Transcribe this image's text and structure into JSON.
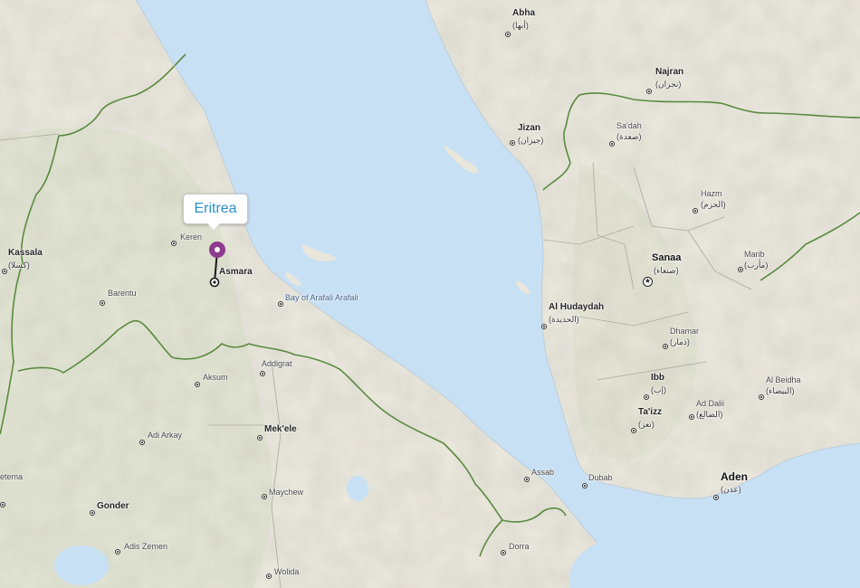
{
  "map": {
    "colors": {
      "water": "#c7e0f4",
      "land": "#e9e6dc",
      "border": "#5a8a3f",
      "pin": "#8e3a8f",
      "callout_text": "#2a8fc8"
    },
    "callout": {
      "label": "Eritrea"
    },
    "marker": {
      "icon": "map-pin-icon",
      "city": "Asmara"
    },
    "places": {
      "abha": "Abha",
      "abha_ar": "(أبها)",
      "najran": "Najran",
      "najran_ar": "(نجران)",
      "jizan": "Jizan",
      "jizan_ar": "(جيزان)",
      "sadah": "Sa'dah",
      "sadah_ar": "(صعدة)",
      "hazm": "Hazm",
      "hazm_ar": "(الحزم)",
      "sanaa": "Sanaa",
      "sanaa_ar": "(صنعاء)",
      "marib": "Marib",
      "marib_ar": "(مأرب)",
      "hudaydah": "Al Hudaydah",
      "hudaydah_ar": "(الحديدة)",
      "dhamar": "Dhamar",
      "dhamar_ar": "(ذمار)",
      "ibb": "Ibb",
      "ibb_ar": "(إب)",
      "taizz": "Ta'izz",
      "taizz_ar": "(تعز)",
      "addalii": "Ad Dalii",
      "addalii_ar": "(الضالع)",
      "albeidha": "Al Beidha",
      "albeidha_ar": "(البيضاء)",
      "aden": "Aden",
      "aden_ar": "(عدن)",
      "dubab": "Dubab",
      "kassala": "Kassala",
      "kassala_ar": "(كسلا)",
      "keren": "Keren",
      "asmara": "Asmara",
      "barentu": "Barentu",
      "bay": "Bay of Arafali Arafali",
      "aksum": "Aksum",
      "adigrat": "Addigrat",
      "adiarkay": "Adi Arkay",
      "mekele": "Mek'ele",
      "gonder": "Gonder",
      "maychew": "Maychew",
      "adiszemen": "Adis Zemen",
      "wolida": "Wolida",
      "assab": "Assab",
      "dorra": "Dorra",
      "metema": "etema"
    }
  }
}
